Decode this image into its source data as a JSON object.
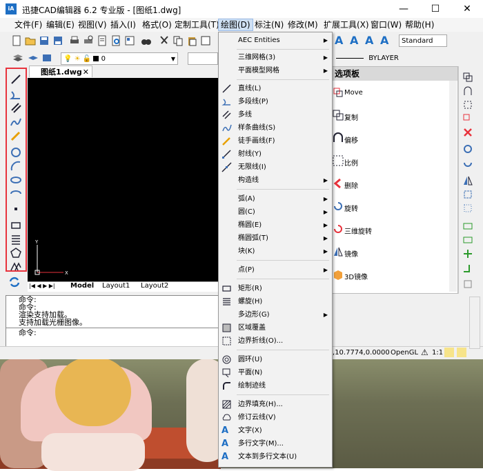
{
  "window": {
    "app_icon": "iA",
    "title": "迅捷CAD编辑器 6.2 专业版 - [图纸1.dwg]",
    "controls": {
      "minimize": "—",
      "maximize": "☐",
      "close": "✕"
    }
  },
  "menubar": [
    {
      "label": "文件(F)"
    },
    {
      "label": "编辑(E)"
    },
    {
      "label": "视图(V)"
    },
    {
      "label": "插入(I)"
    },
    {
      "label": "格式(O)"
    },
    {
      "label": "定制工具(T)"
    },
    {
      "label": "绘图(D)"
    },
    {
      "label": "标注(N)"
    },
    {
      "label": "修改(M)"
    },
    {
      "label": "扩展工具(X)"
    },
    {
      "label": "窗口(W)"
    },
    {
      "label": "帮助(H)"
    }
  ],
  "toolbar": {
    "layer_value": "0",
    "linetype_value": "BYLAYER",
    "text_style": "Standard"
  },
  "document_tab": {
    "label": "图纸1.dwg",
    "close": "✕"
  },
  "layout_tabs": [
    "Model",
    "Layout1",
    "Layout2"
  ],
  "command_lines": [
    "命令:",
    "命令:",
    "渲染支持加载。",
    "支持加载光栅图像。"
  ],
  "command_prompt": "命令:",
  "status": {
    "coords": ",10.7774,0.0000",
    "opengl": "OpenGL",
    "scale": "1:1"
  },
  "palette": {
    "title": "选项板",
    "items": [
      "Move",
      "复制",
      "偏移",
      "比例",
      "删除",
      "旋转",
      "三维旋转",
      "镜像",
      "3D镜像"
    ]
  },
  "draw_menu": {
    "groups": [
      [
        {
          "label": "AEC Entities",
          "submenu": true
        }
      ],
      [
        {
          "label": "三维网格(3)",
          "submenu": true
        },
        {
          "label": "平面模型网格",
          "submenu": true
        }
      ],
      [
        {
          "label": "直线(L)",
          "icon": "line-icon"
        },
        {
          "label": "多段线(P)",
          "icon": "polyline-icon"
        },
        {
          "label": "多线",
          "icon": "multiline-icon"
        },
        {
          "label": "样条曲线(S)",
          "icon": "spline-icon"
        },
        {
          "label": "徒手画线(F)",
          "icon": "freehand-icon"
        },
        {
          "label": "射线(Y)",
          "icon": "ray-icon"
        },
        {
          "label": "无限线(I)",
          "icon": "xline-icon"
        },
        {
          "label": "构造线",
          "submenu": true
        }
      ],
      [
        {
          "label": "弧(A)",
          "submenu": true
        },
        {
          "label": "圆(C)",
          "submenu": true
        },
        {
          "label": "椭圆(E)",
          "submenu": true
        },
        {
          "label": "椭圆弧(T)",
          "submenu": true
        },
        {
          "label": "块(K)",
          "submenu": true
        }
      ],
      [
        {
          "label": "点(P)",
          "submenu": true
        }
      ],
      [
        {
          "label": "矩形(R)",
          "icon": "rectangle-icon"
        },
        {
          "label": "螺旋(H)",
          "icon": "helix-icon"
        },
        {
          "label": "多边形(G)",
          "submenu": true
        },
        {
          "label": "区域覆盖",
          "icon": "wipeout-icon"
        },
        {
          "label": "边界折线(O)...",
          "icon": "boundary-icon"
        }
      ],
      [
        {
          "label": "圆环(U)",
          "icon": "donut-icon"
        },
        {
          "label": "平面(N)",
          "icon": "plane-icon"
        },
        {
          "label": "绘制迹线",
          "icon": "trace-icon"
        }
      ],
      [
        {
          "label": "边界填充(H)...",
          "icon": "hatch-icon"
        },
        {
          "label": "修订云线(V)",
          "icon": "revcloud-icon"
        },
        {
          "label": "文字(X)",
          "icon": "text-icon"
        },
        {
          "label": "多行文字(M)...",
          "icon": "mtext-icon"
        },
        {
          "label": "文本到多行文本(U)",
          "icon": "text-to-mtext-icon"
        }
      ]
    ]
  },
  "colors": {
    "highlight": "#e8323c",
    "accent": "#1e6fc4"
  }
}
